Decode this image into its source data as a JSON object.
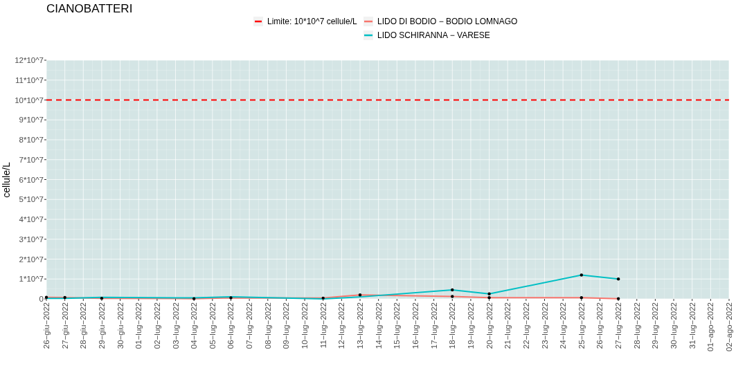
{
  "chart_data": {
    "type": "line",
    "title": "CIANOBATTERI",
    "ylabel": "cellule/L",
    "categories": [
      "26−giu−2022",
      "27−giu−2022",
      "28−giu−2022",
      "29−giu−2022",
      "30−giu−2022",
      "01−lug−2022",
      "02−lug−2022",
      "03−lug−2022",
      "04−lug−2022",
      "05−lug−2022",
      "06−lug−2022",
      "07−lug−2022",
      "08−lug−2022",
      "09−lug−2022",
      "10−lug−2022",
      "11−lug−2022",
      "12−lug−2022",
      "13−lug−2022",
      "14−lug−2022",
      "15−lug−2022",
      "16−lug−2022",
      "17−lug−2022",
      "18−lug−2022",
      "19−lug−2022",
      "20−lug−2022",
      "21−lug−2022",
      "22−lug−2022",
      "23−lug−2022",
      "24−lug−2022",
      "25−lug−2022",
      "26−lug−2022",
      "27−lug−2022",
      "28−lug−2022",
      "29−lug−2022",
      "30−lug−2022",
      "31−lug−2022",
      "01−ago−2022",
      "02−ago−2022"
    ],
    "series": [
      {
        "name": "Limite: 10*10^7 cellule/L",
        "color": "#ff0000",
        "line_style": "dashed",
        "values": [
          100000000,
          100000000,
          100000000,
          100000000,
          100000000,
          100000000,
          100000000,
          100000000,
          100000000,
          100000000,
          100000000,
          100000000,
          100000000,
          100000000,
          100000000,
          100000000,
          100000000,
          100000000,
          100000000,
          100000000,
          100000000,
          100000000,
          100000000,
          100000000,
          100000000,
          100000000,
          100000000,
          100000000,
          100000000,
          100000000,
          100000000,
          100000000,
          100000000,
          100000000,
          100000000,
          100000000,
          100000000,
          100000000
        ]
      },
      {
        "name": "LIDO DI BODIO − BODIO LOMNAGO",
        "color": "#f8766d",
        "values": [
          800000,
          700000,
          null,
          300000,
          null,
          null,
          null,
          null,
          100000,
          null,
          500000,
          null,
          null,
          null,
          null,
          400000,
          null,
          2000000,
          null,
          null,
          null,
          null,
          1200000,
          null,
          600000,
          null,
          null,
          null,
          null,
          600000,
          null,
          100000,
          null,
          null,
          null,
          null,
          null,
          null
        ]
      },
      {
        "name": "LIDO SCHIRANNA − VARESE",
        "color": "#00bfc4",
        "values": [
          300000,
          300000,
          null,
          800000,
          null,
          null,
          null,
          null,
          500000,
          null,
          1000000,
          null,
          null,
          null,
          null,
          0,
          null,
          1000000,
          null,
          null,
          null,
          null,
          4500000,
          null,
          2500000,
          null,
          null,
          null,
          null,
          12000000,
          null,
          10000000,
          null,
          null,
          null,
          null,
          null,
          null
        ]
      }
    ],
    "ylim": [
      0,
      120000000
    ],
    "yticks": [
      {
        "value": 0,
        "label": "0"
      },
      {
        "value": 10000000,
        "label": "1*10^7"
      },
      {
        "value": 20000000,
        "label": "2*10^7"
      },
      {
        "value": 30000000,
        "label": "3*10^7"
      },
      {
        "value": 40000000,
        "label": "4*10^7"
      },
      {
        "value": 50000000,
        "label": "5*10^7"
      },
      {
        "value": 60000000,
        "label": "6*10^7"
      },
      {
        "value": 70000000,
        "label": "7*10^7"
      },
      {
        "value": 80000000,
        "label": "8*10^7"
      },
      {
        "value": 90000000,
        "label": "9*10^7"
      },
      {
        "value": 100000000,
        "label": "10*10^7"
      },
      {
        "value": 110000000,
        "label": "11*10^7"
      },
      {
        "value": 120000000,
        "label": "12*10^7"
      }
    ],
    "grid": true,
    "legend": true
  }
}
